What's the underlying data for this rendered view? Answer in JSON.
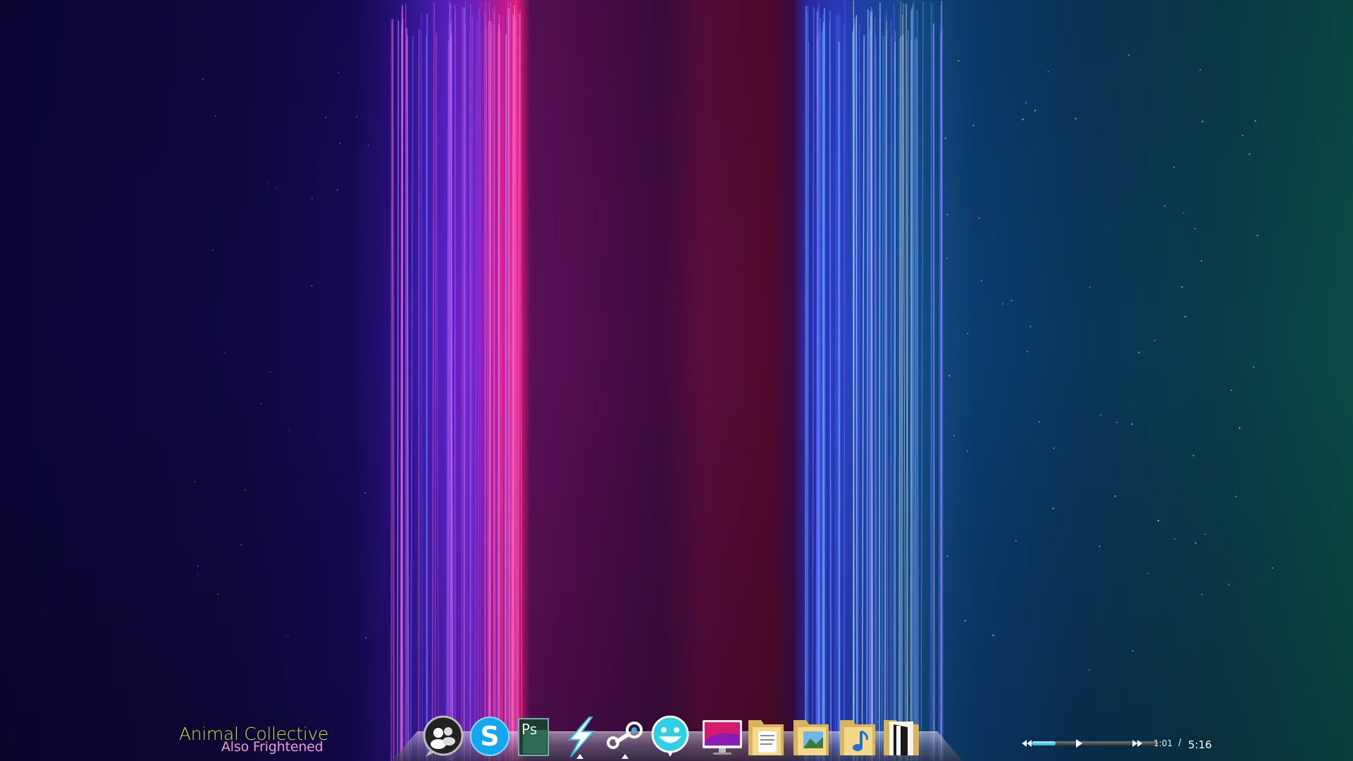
{
  "wallpaper": {
    "name": "abstract-color-spectrum-wallpaper",
    "colors": [
      "#0a0535",
      "#3b1aa5",
      "#f51e86",
      "#4d0d4c",
      "#2c3fc6",
      "#0a3558",
      "#0b4a44"
    ]
  },
  "now_playing": {
    "artist": "Animal Collective",
    "track": "Also Frightened",
    "artist_color": "#c8e23a",
    "track_color": "#f29ad9"
  },
  "dock": {
    "items": [
      {
        "name": "contacts-messenger-icon",
        "label": "Messenger",
        "running": false
      },
      {
        "name": "skype-icon",
        "label": "Skype",
        "running": false
      },
      {
        "name": "photoshop-icon",
        "label": "Ps",
        "running": false
      },
      {
        "name": "winamp-bolt-icon",
        "label": "Winamp",
        "running": true
      },
      {
        "name": "steam-icon",
        "label": "Steam",
        "running": true
      },
      {
        "name": "smiley-chat-icon",
        "label": "Chat",
        "running": false
      },
      {
        "name": "monitor-icon",
        "label": "Desktop",
        "running": false
      },
      {
        "name": "documents-folder-icon",
        "label": "Documents",
        "running": false
      },
      {
        "name": "pictures-folder-icon",
        "label": "Pictures",
        "running": false
      },
      {
        "name": "music-folder-icon",
        "label": "Music",
        "running": false
      },
      {
        "name": "exit-door-icon",
        "label": "Exit",
        "running": false
      }
    ]
  },
  "player": {
    "time_elapsed": "1:01",
    "separator": "/",
    "time_total": "5:16",
    "progress": 0.19,
    "accent": "#27b4d6"
  }
}
